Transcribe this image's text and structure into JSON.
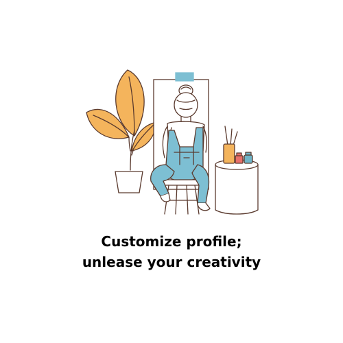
{
  "caption": {
    "line1": "Customize profile;",
    "line2": "unlease your creativity"
  },
  "colors": {
    "background": "#ffffff",
    "outline": "#5a3a2e",
    "leaf_orange": "#f4b45c",
    "overalls_blue": "#7dbfd3",
    "clip_blue": "#7dbfd3",
    "paint_cup_orange": "#f4b45c",
    "paint_jar_red": "#e8706a",
    "paint_jar_teal": "#6fb4c7",
    "text": "#000000"
  },
  "icons": [
    "potted-plant-icon",
    "artist-at-easel-icon",
    "paint-supplies-icon"
  ]
}
